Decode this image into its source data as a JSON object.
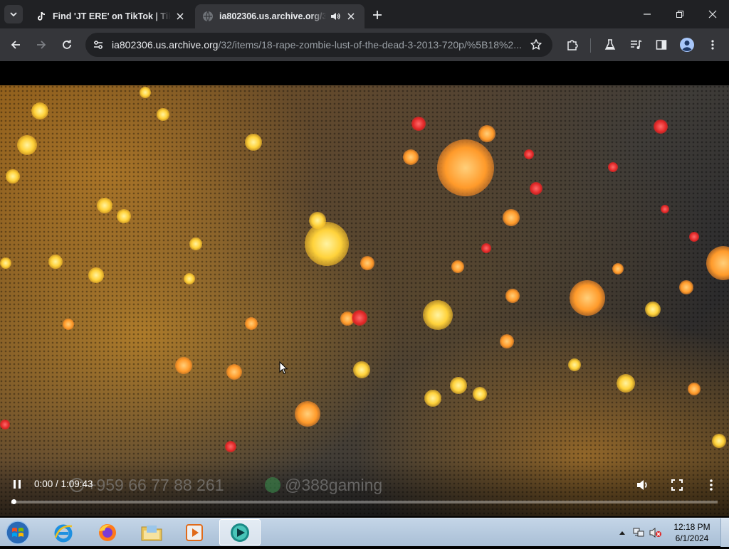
{
  "browser": {
    "tabs": [
      {
        "title": "Find 'JT ERE' on TikTok | TikTok",
        "favicon": "tiktok-icon",
        "active": false
      },
      {
        "title": "ia802306.us.archive.org/32",
        "favicon": "globe-icon",
        "active": true,
        "audio": true
      }
    ],
    "url": {
      "host": "ia802306.us.archive.org",
      "path": "/32/items/18-rape-zombie-lust-of-the-dead-3-2013-720p/%5B18%2..."
    }
  },
  "video": {
    "time_display": "0:00 / 1:09:43",
    "progress": 0.003,
    "watermark_phone": "+959 66 77 88 261",
    "watermark_handle": "@388gaming"
  },
  "taskbar": {
    "apps": [
      "windows-explorer-icon",
      "internet-explorer-icon",
      "firefox-icon",
      "file-explorer-icon",
      "media-player-icon",
      "active-video-app-icon"
    ],
    "clock_time": "12:18 PM",
    "clock_date": "6/1/2024"
  },
  "colors": {
    "tabstrip": "#202124",
    "toolbar": "#35363a",
    "taskbar": "#b4c8dc"
  }
}
